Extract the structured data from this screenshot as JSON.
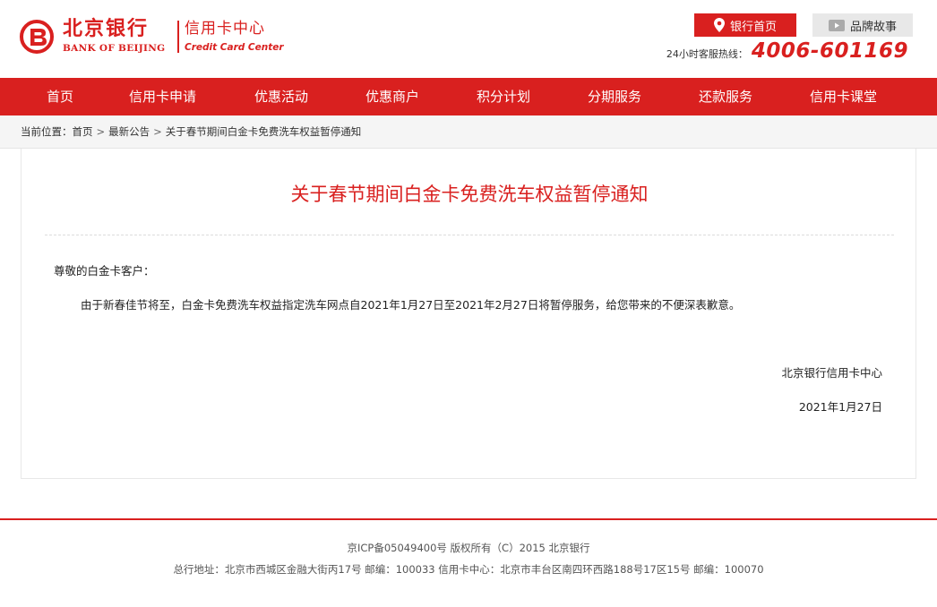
{
  "header": {
    "logo_cn": "北京银行",
    "logo_en": "BANK OF BEIJING",
    "logo_cc_cn": "信用卡中心",
    "logo_cc_en": "Credit Card Center",
    "bank_home_label": "银行首页",
    "brand_story_label": "品牌故事",
    "hotline_label": "24小时客服热线：",
    "hotline_number": "4006-601169",
    "icons": {
      "bank_home": "location-pin-icon",
      "brand_story": "video-play-icon"
    },
    "colors": {
      "brand_red": "#d9201f",
      "secondary_button": "#e8e8e8"
    }
  },
  "nav": {
    "items": [
      {
        "label": "首页"
      },
      {
        "label": "信用卡申请"
      },
      {
        "label": "优惠活动"
      },
      {
        "label": "优惠商户"
      },
      {
        "label": "积分计划"
      },
      {
        "label": "分期服务"
      },
      {
        "label": "还款服务"
      },
      {
        "label": "信用卡课堂"
      }
    ]
  },
  "breadcrumb": {
    "prefix": "当前位置：",
    "items": [
      "首页",
      "最新公告",
      "关于春节期间白金卡免费洗车权益暂停通知"
    ],
    "separator": ">"
  },
  "article": {
    "title": "关于春节期间白金卡免费洗车权益暂停通知",
    "greeting": "尊敬的白金卡客户：",
    "body": "由于新春佳节将至，白金卡免费洗车权益指定洗车网点自2021年1月27日至2021年2月27日将暂停服务，给您带来的不便深表歉意。",
    "signature": "北京银行信用卡中心",
    "date": "2021年1月27日"
  },
  "footer": {
    "line1": "京ICP备05049400号  版权所有（C）2015  北京银行",
    "line2": "总行地址：北京市西城区金融大街丙17号  邮编：100033  信用卡中心：北京市丰台区南四环西路188号17区15号 邮编：100070"
  }
}
